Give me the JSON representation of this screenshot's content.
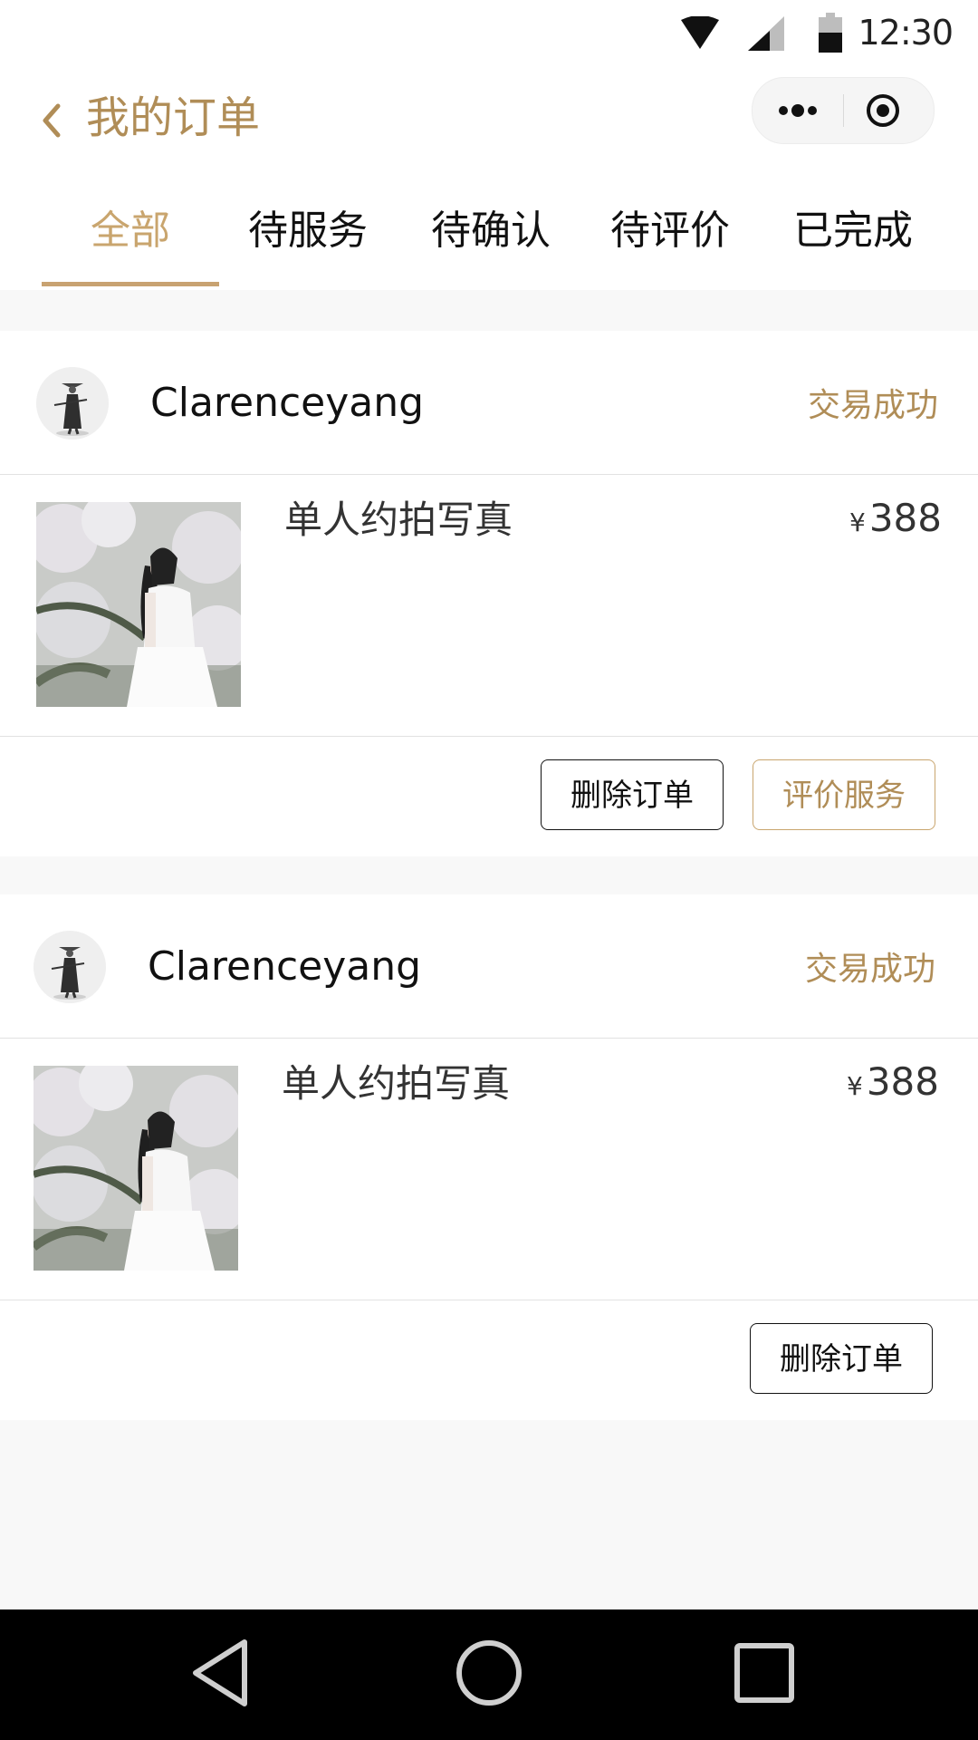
{
  "status_bar": {
    "time": "12:30",
    "icons": [
      "wifi-icon",
      "cellular-signal-icon",
      "battery-icon"
    ]
  },
  "nav": {
    "back_icon": "chevron-left-icon",
    "title": "我的订单",
    "capsule_icons": [
      "more-dots-icon",
      "target-icon"
    ]
  },
  "tabs": [
    {
      "label": "全部",
      "active": true
    },
    {
      "label": "待服务",
      "active": false
    },
    {
      "label": "待确认",
      "active": false
    },
    {
      "label": "待评价",
      "active": false
    },
    {
      "label": "已完成",
      "active": false
    }
  ],
  "orders": [
    {
      "username": "Clarenceyang",
      "status": "交易成功",
      "product": "单人约拍写真",
      "currency": "¥",
      "price": "388",
      "buttons": [
        "删除订单",
        "评价服务"
      ]
    },
    {
      "username": "Clarenceyang",
      "status": "交易成功",
      "product": "单人约拍写真",
      "currency": "¥",
      "price": "388",
      "buttons": [
        "删除订单"
      ]
    }
  ],
  "android_nav": [
    "back-triangle-icon",
    "home-circle-icon",
    "recents-square-icon"
  ],
  "colors": {
    "accent": "#b08d57",
    "tab_active": "#c9a56e",
    "background": "#f8f8f8"
  }
}
